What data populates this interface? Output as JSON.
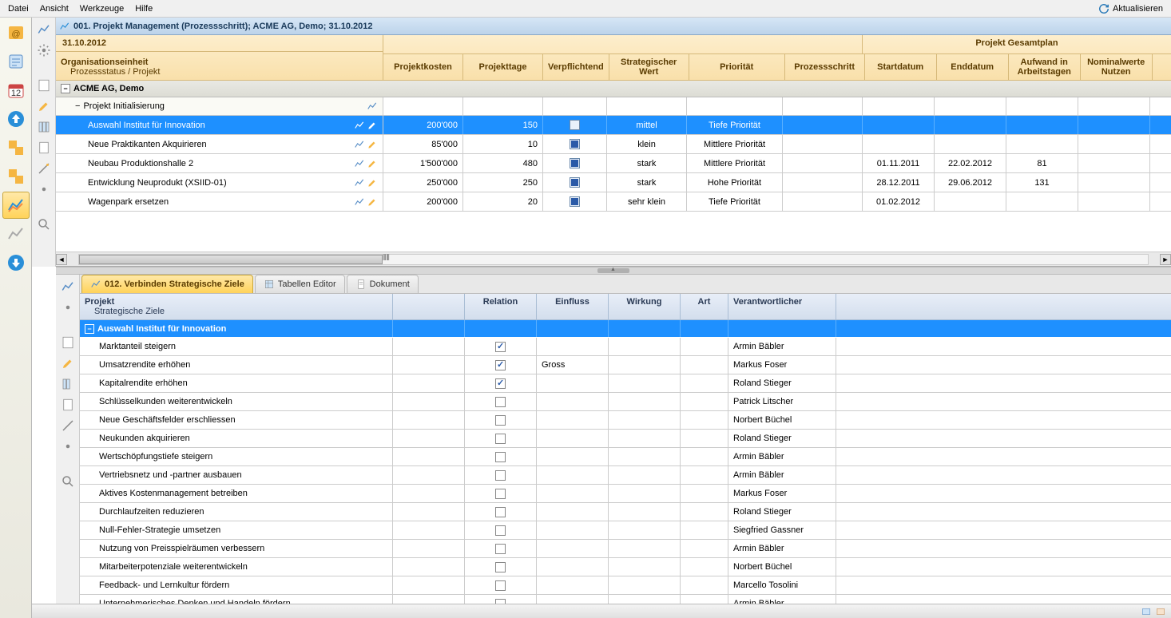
{
  "menu": {
    "items": [
      "Datei",
      "Ansicht",
      "Werkzeuge",
      "Hilfe"
    ],
    "refresh": "Aktualisieren"
  },
  "doc_title": "001. Projekt Management (Prozessschritt); ACME AG, Demo; 31.10.2012",
  "top": {
    "date": "31.10.2012",
    "headers": {
      "org_unit": "Organisationseinheit",
      "org_sub": "Prozessstatus / Projekt",
      "cols": [
        "Projektkosten",
        "Projekttage",
        "Verpflichtend",
        "Strategischer Wert",
        "Priorität",
        "Prozessschritt"
      ],
      "plan_title": "Projekt Gesamtplan",
      "plan_cols": [
        "Startdatum",
        "Enddatum",
        "Aufwand in Arbeitstagen",
        "Nominalwerte Nutzen"
      ]
    },
    "group": "ACME AG, Demo",
    "subgroup": "Projekt Initialisierung",
    "rows": [
      {
        "name": "Auswahl Institut für Innovation",
        "kosten": "200'000",
        "tage": "150",
        "verpfl": false,
        "wert": "mittel",
        "prio": "Tiefe Priorität",
        "schritt": "",
        "start": "",
        "end": "",
        "aufwand": "",
        "selected": true
      },
      {
        "name": "Neue Praktikanten Akquirieren",
        "kosten": "85'000",
        "tage": "10",
        "verpfl": true,
        "wert": "klein",
        "prio": "Mittlere Priorität",
        "schritt": "",
        "start": "",
        "end": "",
        "aufwand": ""
      },
      {
        "name": "Neubau Produktionshalle 2",
        "kosten": "1'500'000",
        "tage": "480",
        "verpfl": true,
        "wert": "stark",
        "prio": "Mittlere Priorität",
        "schritt": "",
        "start": "01.11.2011",
        "end": "22.02.2012",
        "aufwand": "81"
      },
      {
        "name": "Entwicklung Neuprodukt (XSIID-01)",
        "kosten": "250'000",
        "tage": "250",
        "verpfl": true,
        "wert": "stark",
        "prio": "Hohe Priorität",
        "schritt": "",
        "start": "28.12.2011",
        "end": "29.06.2012",
        "aufwand": "131"
      },
      {
        "name": "Wagenpark ersetzen",
        "kosten": "200'000",
        "tage": "20",
        "verpfl": true,
        "wert": "sehr klein",
        "prio": "Tiefe Priorität",
        "schritt": "",
        "start": "01.02.2012",
        "end": "",
        "aufwand": ""
      }
    ]
  },
  "tabs": [
    {
      "label": "012. Verbinden Strategische Ziele",
      "active": true
    },
    {
      "label": "Tabellen Editor",
      "active": false
    },
    {
      "label": "Dokument",
      "active": false
    }
  ],
  "bottom": {
    "headers": {
      "proj": "Projekt",
      "proj_sub": "Strategische Ziele",
      "cols": [
        "Relation",
        "Einfluss",
        "Wirkung",
        "Art",
        "Verantwortlicher"
      ]
    },
    "group": "Auswahl Institut für Innovation",
    "rows": [
      {
        "name": "Marktanteil steigern",
        "rel": true,
        "einfluss": "",
        "wirk": "",
        "art": "",
        "ver": "Armin Bäbler"
      },
      {
        "name": "Umsatzrendite erhöhen",
        "rel": true,
        "einfluss": "Gross",
        "wirk": "",
        "art": "",
        "ver": "Markus Foser"
      },
      {
        "name": "Kapitalrendite erhöhen",
        "rel": true,
        "einfluss": "",
        "wirk": "",
        "art": "",
        "ver": "Roland Stieger"
      },
      {
        "name": "Schlüsselkunden weiterentwickeln",
        "rel": false,
        "einfluss": "",
        "wirk": "",
        "art": "",
        "ver": "Patrick Litscher"
      },
      {
        "name": "Neue Geschäftsfelder erschliessen",
        "rel": false,
        "einfluss": "",
        "wirk": "",
        "art": "",
        "ver": "Norbert Büchel"
      },
      {
        "name": "Neukunden akquirieren",
        "rel": false,
        "einfluss": "",
        "wirk": "",
        "art": "",
        "ver": "Roland Stieger"
      },
      {
        "name": "Wertschöpfungstiefe steigern",
        "rel": false,
        "einfluss": "",
        "wirk": "",
        "art": "",
        "ver": "Armin Bäbler"
      },
      {
        "name": "Vertriebsnetz und -partner ausbauen",
        "rel": false,
        "einfluss": "",
        "wirk": "",
        "art": "",
        "ver": "Armin Bäbler"
      },
      {
        "name": "Aktives Kostenmanagement betreiben",
        "rel": false,
        "einfluss": "",
        "wirk": "",
        "art": "",
        "ver": "Markus Foser"
      },
      {
        "name": "Durchlaufzeiten reduzieren",
        "rel": false,
        "einfluss": "",
        "wirk": "",
        "art": "",
        "ver": "Roland Stieger"
      },
      {
        "name": "Null-Fehler-Strategie umsetzen",
        "rel": false,
        "einfluss": "",
        "wirk": "",
        "art": "",
        "ver": "Siegfried Gassner"
      },
      {
        "name": "Nutzung von Preisspielräumen verbessern",
        "rel": false,
        "einfluss": "",
        "wirk": "",
        "art": "",
        "ver": "Armin Bäbler"
      },
      {
        "name": "Mitarbeiterpotenziale weiterentwickeln",
        "rel": false,
        "einfluss": "",
        "wirk": "",
        "art": "",
        "ver": "Norbert Büchel"
      },
      {
        "name": "Feedback- und Lernkultur fördern",
        "rel": false,
        "einfluss": "",
        "wirk": "",
        "art": "",
        "ver": "Marcello Tosolini"
      },
      {
        "name": "Unternehmerisches Denken und Handeln fördern",
        "rel": false,
        "einfluss": "",
        "wirk": "",
        "art": "",
        "ver": "Armin Bäbler"
      }
    ]
  },
  "widths": {
    "top_name": 410,
    "kosten": 100,
    "tage": 100,
    "verpfl": 80,
    "wert": 100,
    "prio": 120,
    "schritt": 100,
    "start": 90,
    "end": 90,
    "aufwand": 90,
    "nutzen": 90,
    "bot_name": 392,
    "bot_blank": 90,
    "rel": 90,
    "einfluss": 90,
    "wirk": 90,
    "art": 60,
    "ver": 135
  }
}
